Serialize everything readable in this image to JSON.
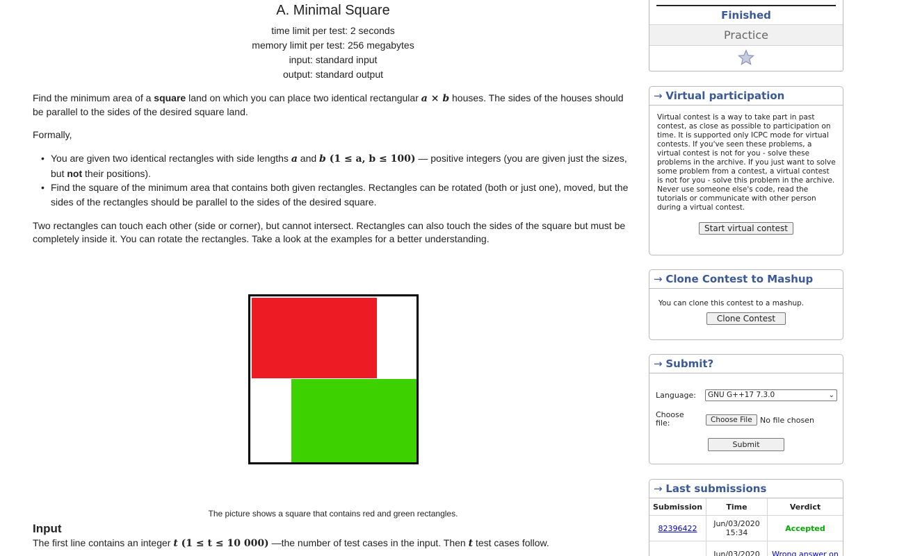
{
  "problem": {
    "title": "A. Minimal Square",
    "time_limit": "time limit per test: 2 seconds",
    "memory_limit": "memory limit per test: 256 megabytes",
    "input": "input: standard input",
    "output": "output: standard output"
  },
  "statement": {
    "p1_a": "Find the minimum area of a ",
    "p1_bold": "square",
    "p1_b": " land on which you can place two identical rectangular ",
    "p1_math_a": "a",
    "p1_times": " × ",
    "p1_math_b": "b",
    "p1_c": " houses. The sides of the houses should be parallel to the sides of the desired square land.",
    "formally": "Formally,",
    "b1_a": "You are given two identical rectangles with side lengths ",
    "b1_math_a": "a",
    "b1_and": " and ",
    "b1_math_b": "b",
    "b1_constraint": " (1 ≤ a, b ≤ 100)",
    "b1_b": " — positive integers (you are given just the sizes, but ",
    "b1_bold": "not",
    "b1_c": " their positions).",
    "b2": "Find the square of the minimum area that contains both given rectangles. Rectangles can be rotated (both or just one), moved, but the sides of the rectangles should be parallel to the sides of the desired square.",
    "p2": "Two rectangles can touch each other (side or corner), but cannot intersect. Rectangles can also touch the sides of the square but must be completely inside it. You can rotate the rectangles. Take a look at the examples for a better understanding.",
    "caption": "The picture shows a square that contains red and green rectangles.",
    "input_title": "Input",
    "input_a": "The first line contains an integer ",
    "input_math_t": "t",
    "input_constraint": " (1 ≤ t ≤ 10 000)",
    "input_b": " —the number of test cases in the input. Then ",
    "input_math_t2": "t",
    "input_c": " test cases follow."
  },
  "figure": {
    "red_color": "#ed1c24",
    "green_color": "#3dd100"
  },
  "sidebar": {
    "status": {
      "finished": "Finished",
      "practice": "Practice",
      "star_icon": "star-icon"
    },
    "virtual": {
      "title": "Virtual participation",
      "text": "Virtual contest is a way to take part in past contest, as close as possible to participation on time. It is supported only ICPC mode for virtual contests. If you've seen these problems, a virtual contest is not for you - solve these problems in the archive. If you just want to solve some problem from a contest, a virtual contest is not for you - solve this problem in the archive. Never use someone else's code, read the tutorials or communicate with other person during a virtual contest.",
      "button": "Start virtual contest"
    },
    "clone": {
      "title": "Clone Contest to Mashup",
      "text": "You can clone this contest to a mashup.",
      "button": "Clone Contest"
    },
    "submit": {
      "title": "Submit?",
      "language_label": "Language:",
      "language_value": "GNU G++17 7.3.0",
      "file_label": "Choose file:",
      "choose_button": "Choose File",
      "no_file": "No file chosen",
      "submit_button": "Submit"
    },
    "last": {
      "title": "Last submissions",
      "headers": [
        "Submission",
        "Time",
        "Verdict"
      ],
      "rows": [
        {
          "id": "82396422",
          "time": "Jun/03/2020 15:34",
          "verdict": "Accepted"
        },
        {
          "id": "",
          "time": "Jun/03/2020",
          "verdict": "Wrong answer on"
        }
      ]
    },
    "colors": {
      "caption": "#3b5998",
      "accepted": "#00a900",
      "wrong": "#0000cc"
    }
  }
}
